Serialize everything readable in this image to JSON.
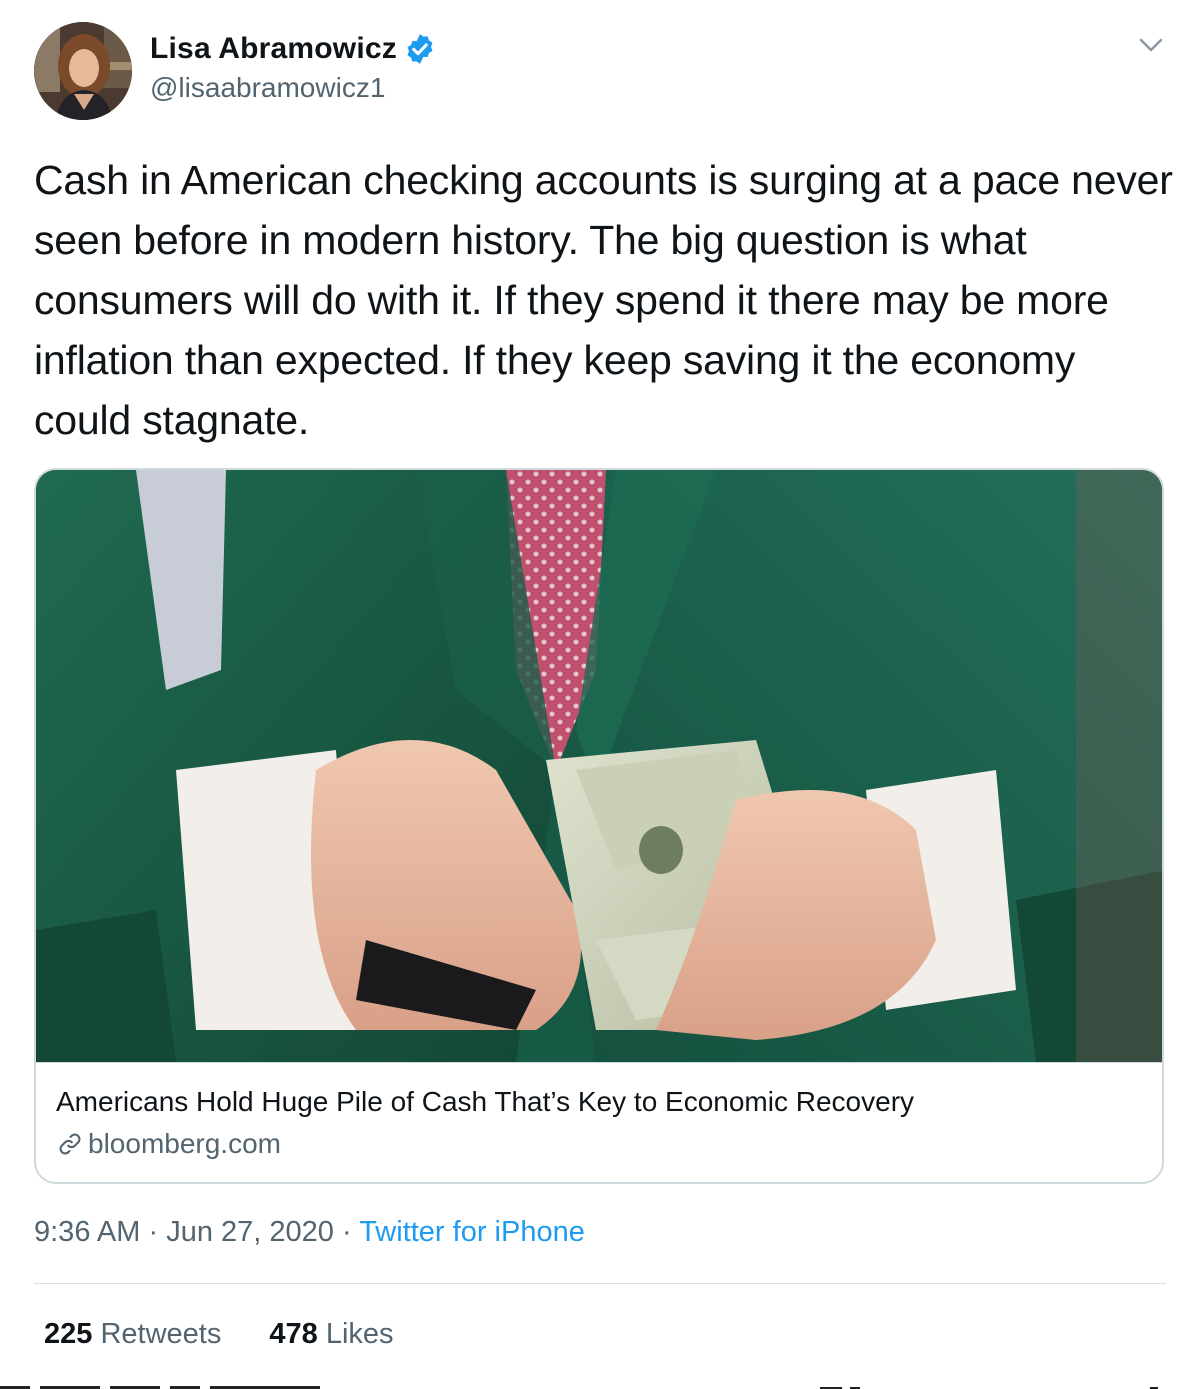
{
  "author": {
    "display_name": "Lisa Abramowicz",
    "handle": "@lisaabramowicz1",
    "verified": true
  },
  "icons": {
    "verified": "verified-badge-icon",
    "menu": "chevron-down-icon",
    "link": "link-icon"
  },
  "tweet": {
    "text": "Cash in American checking accounts is surging at a pace never seen before in modern history. The big question is what consumers will do with it. If they spend it there may be more inflation than expected. If they keep saving it the economy could stagnate."
  },
  "card": {
    "title": "Americans Hold Huge Pile of Cash That’s Key to Economic Recovery",
    "domain": "bloomberg.com"
  },
  "meta": {
    "time": "9:36 AM",
    "separator": "·",
    "date": "Jun 27, 2020",
    "app": "Twitter for iPhone"
  },
  "stats": {
    "retweets_count": "225",
    "retweets_label": "Retweets",
    "likes_count": "478",
    "likes_label": "Likes"
  },
  "colors": {
    "accent": "#1d9bf0",
    "text": "#0f1419",
    "secondary": "#536471",
    "border": "#cfd9de"
  }
}
